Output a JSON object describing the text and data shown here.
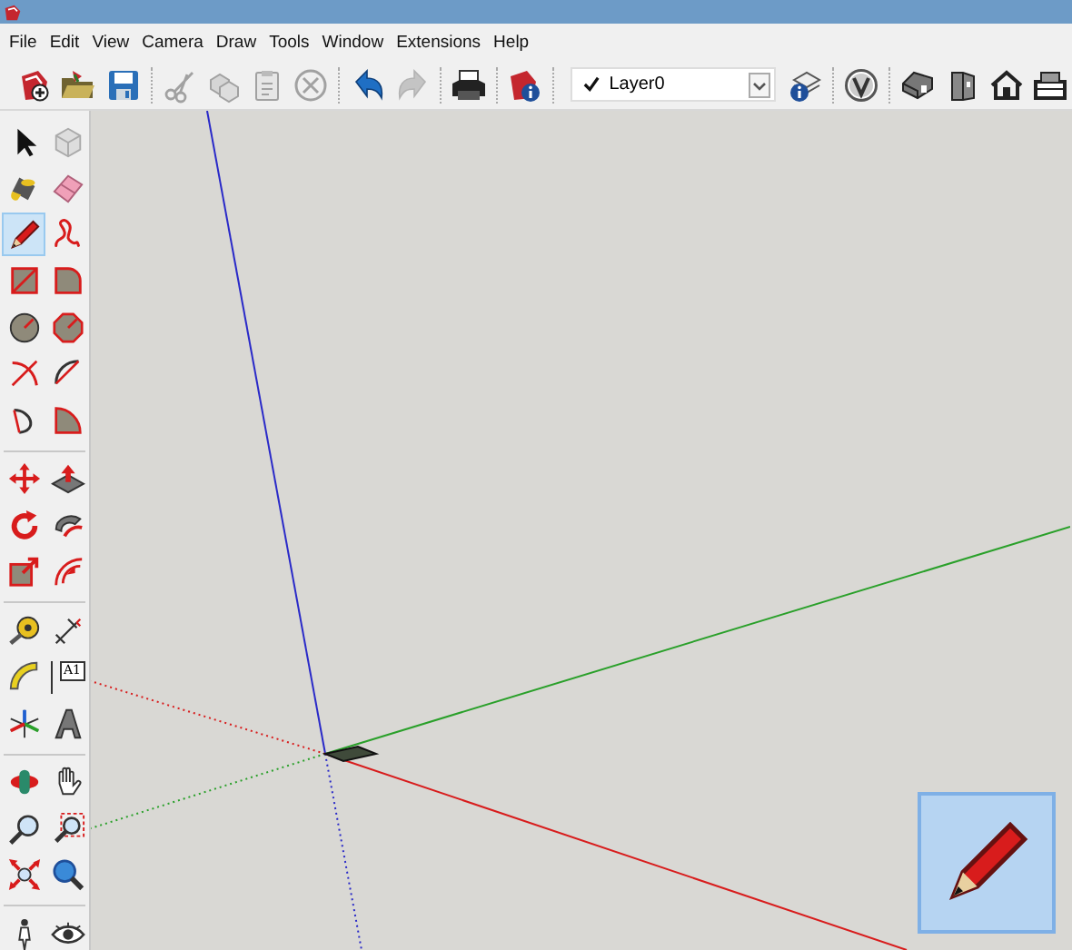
{
  "menu": [
    "File",
    "Edit",
    "View",
    "Camera",
    "Draw",
    "Tools",
    "Window",
    "Extensions",
    "Help"
  ],
  "toolbar": [
    {
      "kind": "new",
      "disabled": false
    },
    {
      "kind": "open",
      "disabled": false
    },
    {
      "kind": "save",
      "disabled": false
    },
    {
      "kind": "separator"
    },
    {
      "kind": "cut",
      "disabled": true
    },
    {
      "kind": "copy",
      "disabled": true
    },
    {
      "kind": "paste",
      "disabled": true
    },
    {
      "kind": "erase",
      "disabled": true
    },
    {
      "kind": "separator"
    },
    {
      "kind": "undo",
      "disabled": false
    },
    {
      "kind": "redo",
      "disabled": true
    },
    {
      "kind": "separator"
    },
    {
      "kind": "print",
      "disabled": false
    },
    {
      "kind": "separator"
    },
    {
      "kind": "model-info",
      "disabled": false
    },
    {
      "kind": "separator"
    },
    {
      "kind": "layer-select",
      "value": "Layer0",
      "checked": true
    },
    {
      "kind": "layers",
      "disabled": false
    },
    {
      "kind": "separator"
    },
    {
      "kind": "styles",
      "disabled": false
    },
    {
      "kind": "separator"
    },
    {
      "kind": "iso",
      "disabled": false
    },
    {
      "kind": "front",
      "disabled": false
    },
    {
      "kind": "top",
      "disabled": false
    },
    {
      "kind": "side",
      "disabled": false
    }
  ],
  "tool_groups": [
    {
      "tools": [
        {
          "kind": "select",
          "selected": false
        },
        {
          "kind": "component",
          "selected": false
        },
        {
          "kind": "paint",
          "selected": false
        },
        {
          "kind": "eraser",
          "selected": false
        },
        {
          "kind": "pencil",
          "selected": true
        },
        {
          "kind": "freehand",
          "selected": false
        },
        {
          "kind": "rectangle",
          "selected": false
        },
        {
          "kind": "rotated-rectangle",
          "selected": false
        },
        {
          "kind": "circle",
          "selected": false
        },
        {
          "kind": "polygon",
          "selected": false
        },
        {
          "kind": "arc",
          "selected": false
        },
        {
          "kind": "arc2",
          "selected": false
        },
        {
          "kind": "arc3",
          "selected": false
        },
        {
          "kind": "pie",
          "selected": false
        }
      ]
    },
    {
      "tools": [
        {
          "kind": "move",
          "selected": false
        },
        {
          "kind": "pushpull",
          "selected": false
        },
        {
          "kind": "rotate",
          "selected": false
        },
        {
          "kind": "followme",
          "selected": false
        },
        {
          "kind": "scale",
          "selected": false
        },
        {
          "kind": "offset",
          "selected": false
        }
      ]
    },
    {
      "tools": [
        {
          "kind": "tape",
          "selected": false
        },
        {
          "kind": "dimension",
          "selected": false
        },
        {
          "kind": "protractor",
          "selected": false
        },
        {
          "kind": "text",
          "label": "A1",
          "selected": false
        },
        {
          "kind": "axes",
          "selected": false
        },
        {
          "kind": "solidtext",
          "selected": false
        }
      ]
    },
    {
      "tools": [
        {
          "kind": "orbit",
          "selected": false
        },
        {
          "kind": "pan",
          "selected": false
        },
        {
          "kind": "zoom",
          "selected": false
        },
        {
          "kind": "zoom-window",
          "selected": false
        },
        {
          "kind": "zoom-extents",
          "selected": false
        },
        {
          "kind": "previous",
          "selected": false
        }
      ]
    },
    {
      "tools": [
        {
          "kind": "walk",
          "selected": false
        },
        {
          "kind": "look",
          "selected": false
        }
      ]
    }
  ],
  "tool_preview": {
    "kind": "pencil"
  }
}
